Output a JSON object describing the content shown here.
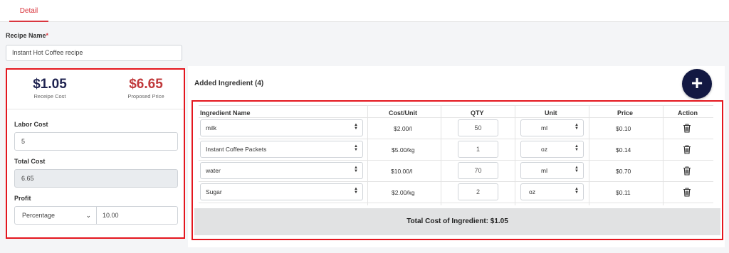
{
  "tabs": [
    {
      "label": "Detail"
    }
  ],
  "recipe": {
    "label": "Recipe Name",
    "required_mark": "*",
    "value": "Instant Hot Coffee recipe"
  },
  "summary": {
    "recipe_cost": "$1.05",
    "recipe_cost_label": "Receipe Cost",
    "proposed_price": "$6.65",
    "proposed_price_label": "Proposed Price"
  },
  "form": {
    "labor_cost_label": "Labor Cost",
    "labor_cost_value": "5",
    "total_cost_label": "Total Cost",
    "total_cost_value": "6.65",
    "profit_label": "Profit",
    "profit_type": "Percentage",
    "profit_value": "10.00"
  },
  "ingredients": {
    "title": "Added Ingredient (4)",
    "add_button": "+",
    "columns": [
      "Ingredient Name",
      "Cost/Unit",
      "QTY",
      "Unit",
      "Price",
      "Action"
    ],
    "rows": [
      {
        "name": "milk",
        "cost_unit": "$2.00/l",
        "qty": "50",
        "unit": "ml",
        "price": "$0.10"
      },
      {
        "name": "Instant Coffee Packets",
        "cost_unit": "$5.00/kg",
        "qty": "1",
        "unit": "oz",
        "price": "$0.14"
      },
      {
        "name": "water",
        "cost_unit": "$10.00/l",
        "qty": "70",
        "unit": "ml",
        "price": "$0.70"
      },
      {
        "name": "Sugar",
        "cost_unit": "$2.00/kg",
        "qty": "2",
        "unit": "oz",
        "price": "$0.11"
      }
    ],
    "total": "Total Cost of Ingredient: $1.05"
  },
  "colors": {
    "accent_red": "#d9363e",
    "navy": "#121842",
    "highlight_border": "#e4161e"
  }
}
